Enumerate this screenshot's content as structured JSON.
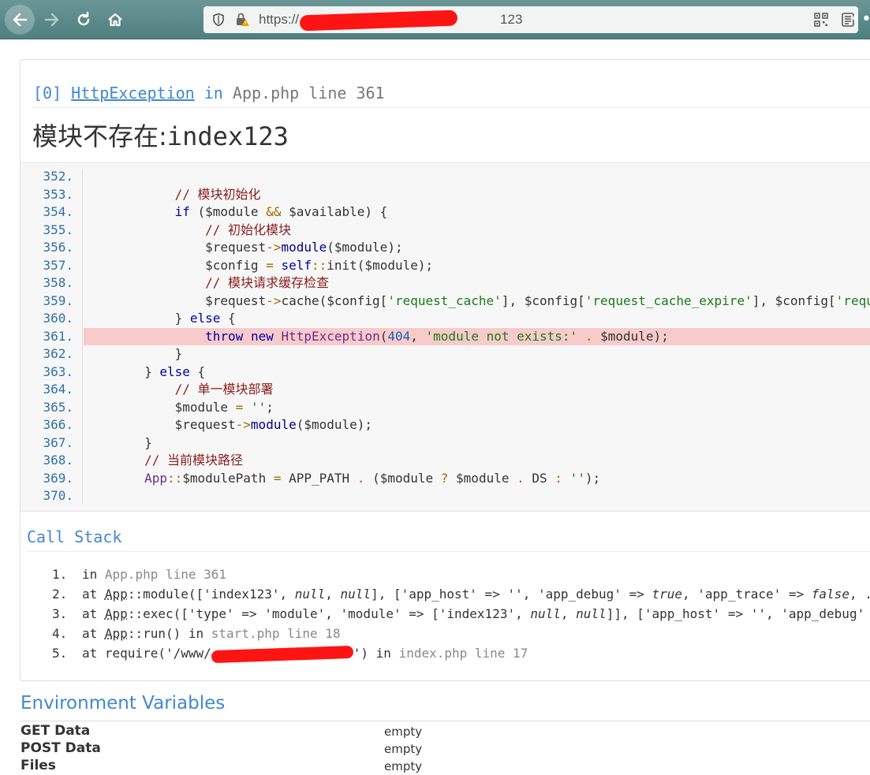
{
  "browser": {
    "url_prefix": "https://",
    "url_suffix": "123"
  },
  "exception": {
    "index": "[0]",
    "class": "HttpException",
    "in_label": "in",
    "location": "App.php line 361",
    "message_cn": "模块不存在:",
    "message_code": "index123"
  },
  "source_lines": [
    {
      "no": "352.",
      "html": ""
    },
    {
      "no": "353.",
      "html": "            <span class='c-com'>// 模块初始化</span>"
    },
    {
      "no": "354.",
      "html": "            <span class='c-kw'>if</span> ($module <span class='c-op'>&amp;&amp;</span> $available) {"
    },
    {
      "no": "355.",
      "html": "                <span class='c-com'>// 初始化模块</span>"
    },
    {
      "no": "356.",
      "html": "                $request<span class='c-op'>-&gt;</span><span class='c-fn'>module</span>($module);"
    },
    {
      "no": "357.",
      "html": "                $config <span class='c-op'>=</span> <span class='c-kw'>self</span><span class='c-op'>::</span>init($module);"
    },
    {
      "no": "358.",
      "html": "                <span class='c-com'>// 模块请求缓存检查</span>"
    },
    {
      "no": "359.",
      "html": "                $request<span class='c-op'>-&gt;</span>cache($config[<span class='c-str'>'request_cache'</span>], $config[<span class='c-str'>'request_cache_expire'</span>], $config[<span class='c-str'>'requ</span>"
    },
    {
      "no": "360.",
      "html": "            } <span class='c-kw'>else</span> {"
    },
    {
      "no": "361.",
      "html": "                <span class='c-kw'>throw</span> <span class='c-kw'>new</span> <span class='c-cls'>HttpException</span>(<span class='c-num'>404</span>, <span class='c-str'>'module not exists:'</span> <span class='c-op'>.</span> $module);",
      "highlight": true
    },
    {
      "no": "362.",
      "html": "            }"
    },
    {
      "no": "363.",
      "html": "        } <span class='c-kw'>else</span> {"
    },
    {
      "no": "364.",
      "html": "            <span class='c-com'>// 单一模块部署</span>"
    },
    {
      "no": "365.",
      "html": "            $module <span class='c-op'>=</span> <span class='c-str'>''</span>;"
    },
    {
      "no": "366.",
      "html": "            $request<span class='c-op'>-&gt;</span><span class='c-fn'>module</span>($module);"
    },
    {
      "no": "367.",
      "html": "        }"
    },
    {
      "no": "368.",
      "html": "        <span class='c-com'>// 当前模块路径</span>"
    },
    {
      "no": "369.",
      "html": "        <span class='c-cls'>App</span><span class='c-op'>::</span>$modulePath <span class='c-op'>=</span> APP_PATH <span class='c-op'>.</span> ($module <span class='c-op'>?</span> $module <span class='c-op'>.</span> DS <span class='c-op'>:</span> <span class='c-str'>''</span>);"
    },
    {
      "no": "370.",
      "html": ""
    }
  ],
  "call_stack": {
    "title": "Call Stack",
    "items": [
      {
        "no": "1.",
        "html": "in <span class='file'>App.php line 361</span>"
      },
      {
        "no": "2.",
        "html": "at <span class='cls'>App</span>::module(['index123', <i>null</i>, <i>null</i>], ['app_host' =&gt; '', 'app_debug' =&gt; <i>true</i>, 'app_trace' =&gt; <i>false</i>, ..."
      },
      {
        "no": "3.",
        "html": "at <span class='cls'>App</span>::exec(['type' =&gt; 'module', 'module' =&gt; ['index123', <i>null</i>, <i>null</i>]], ['app_host' =&gt; '', 'app_debug'"
      },
      {
        "no": "4.",
        "html": "at <span class='cls'>App</span>::run() in <span class='file'>start.php line 18</span>"
      },
      {
        "no": "5.",
        "html": "at require('/www/<span class='redact2'></span>') in <span class='file'>index.php line 17</span>"
      }
    ]
  },
  "environment": {
    "title": "Environment Variables",
    "rows": [
      {
        "key": "GET Data",
        "value": "empty"
      },
      {
        "key": "POST Data",
        "value": "empty"
      },
      {
        "key": "Files",
        "value": "empty"
      }
    ]
  }
}
